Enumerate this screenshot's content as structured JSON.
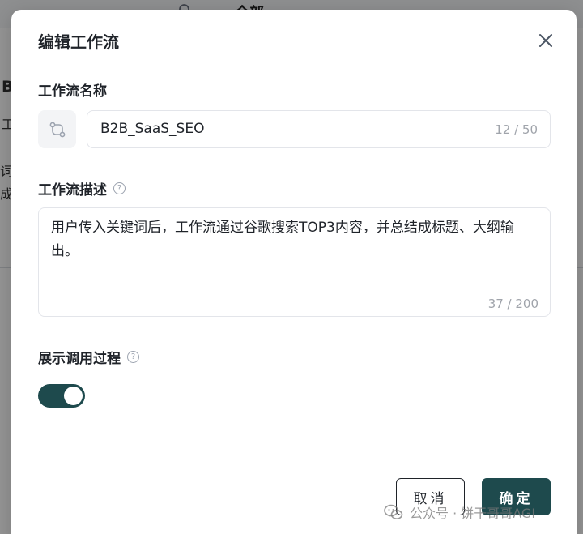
{
  "background": {
    "search_icon": "search-icon",
    "tab_label": "全部",
    "side_text_1": "B",
    "side_text_2": "工",
    "side_text_3": "词",
    "side_text_4": "成"
  },
  "modal": {
    "title": "编辑工作流",
    "close_icon": "close-icon",
    "name_section": {
      "label": "工作流名称",
      "icon": "workflow-icon",
      "value": "B2B_SaaS_SEO",
      "counter": "12 / 50"
    },
    "description_section": {
      "label": "工作流描述",
      "help_icon": "help-icon",
      "value": "用户传入关键词后，工作流通过谷歌搜索TOP3内容，并总结成标题、大纲输出。",
      "counter": "37 / 200"
    },
    "show_process_section": {
      "label": "展示调用过程",
      "help_icon": "help-icon",
      "toggle_on": true
    },
    "buttons": {
      "cancel": "取消",
      "confirm": "确定"
    }
  },
  "watermark": {
    "icon": "wechat-icon",
    "text": "公众号 · 饼干哥哥AGI"
  },
  "colors": {
    "accent": "#1e4a4d",
    "text_primary": "#1f2329",
    "text_muted": "#a0a4ab",
    "border": "#e3e5ea"
  }
}
